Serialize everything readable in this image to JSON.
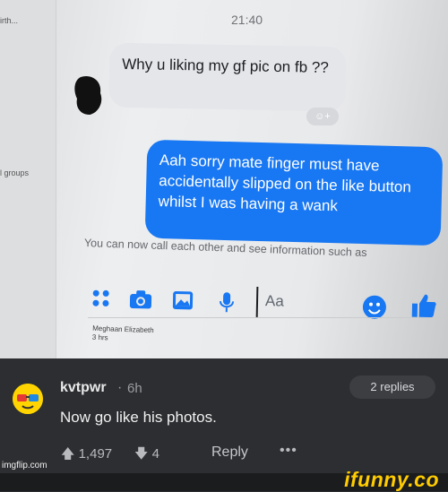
{
  "sidebar": {
    "top_label": "irth...",
    "groups_label": "l groups"
  },
  "chat": {
    "time": "21:40",
    "incoming_message": "Why u liking my gf pic on fb ??",
    "react_add": "☺+",
    "outgoing_message": "Aah sorry mate finger must have accidentally slipped on the like button whilst I was having a wank",
    "call_info": "You can now call each other and see information such as",
    "composer_placeholder": "Aa",
    "footer_name": "Meghaan Elizabeth",
    "footer_time": "3 hrs"
  },
  "comment": {
    "username": "kvtpwr",
    "separator": "·",
    "age": "6h",
    "replies_label": "2 replies",
    "text": "Now go like his photos.",
    "upvotes": "1,497",
    "downvotes": "4",
    "reply_label": "Reply",
    "more_label": "•••"
  },
  "watermarks": {
    "imgflip": "imgflip.com",
    "ifunny": "ifunny.co"
  },
  "colors": {
    "messenger_blue": "#1877f2",
    "bubble_grey": "#e4e6e9",
    "dark_bg": "#2c2e31",
    "ifunny_yellow": "#ffcc00"
  }
}
